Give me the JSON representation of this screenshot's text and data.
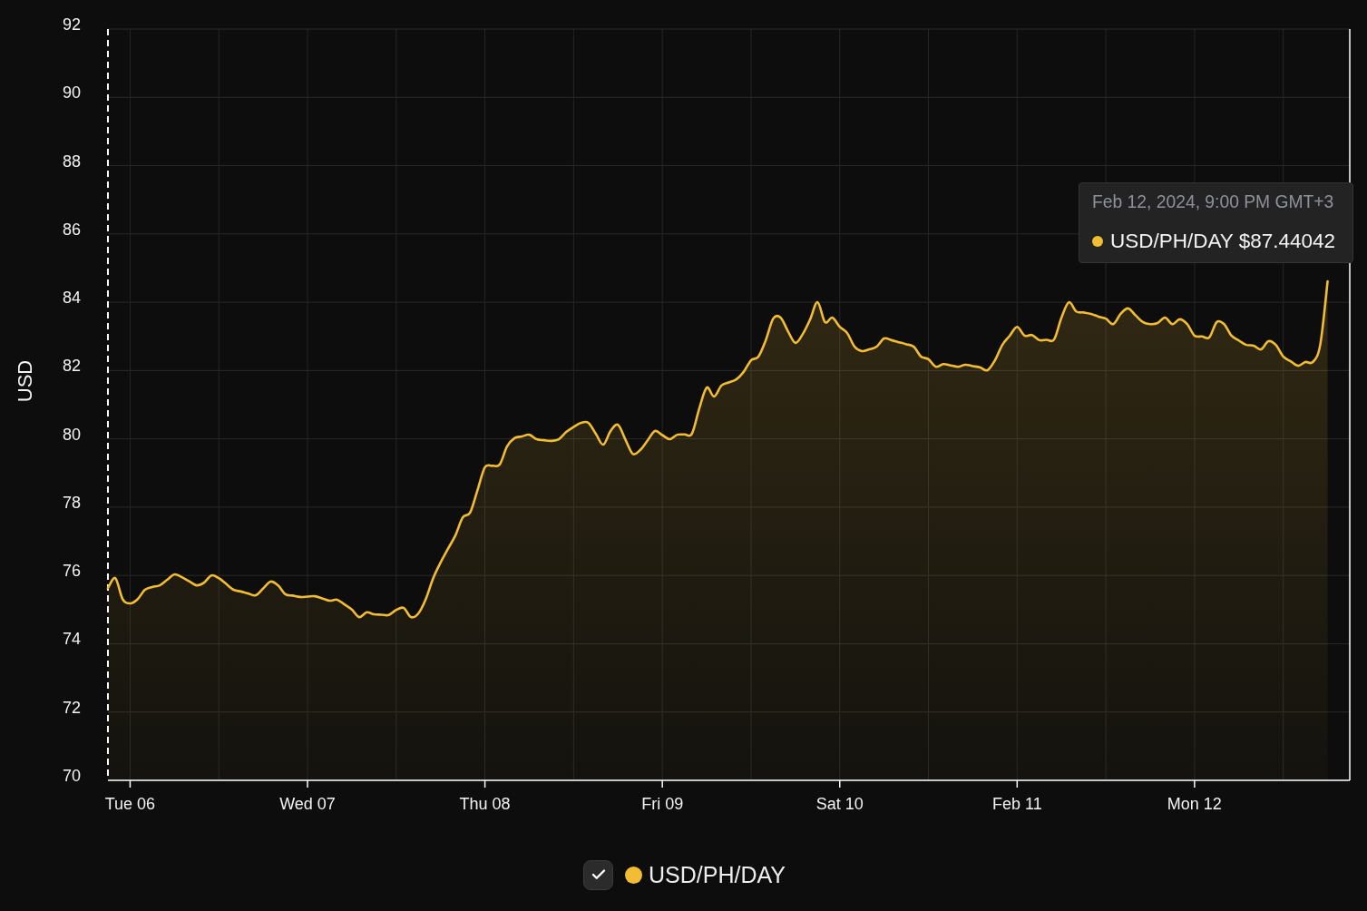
{
  "chart": {
    "chart_data": {
      "type": "area",
      "ylabel": "USD",
      "grid": true,
      "categories": [
        null,
        null,
        null,
        "Tue 06",
        null,
        null,
        null,
        null,
        null,
        null,
        null,
        null,
        null,
        null,
        null,
        null,
        null,
        null,
        null,
        null,
        null,
        null,
        null,
        null,
        null,
        null,
        null,
        "Wed 07",
        null,
        null,
        null,
        null,
        null,
        null,
        null,
        null,
        null,
        null,
        null,
        null,
        null,
        null,
        null,
        null,
        null,
        null,
        null,
        null,
        null,
        null,
        null,
        "Thu 08",
        null,
        null,
        null,
        null,
        null,
        null,
        null,
        null,
        null,
        null,
        null,
        null,
        null,
        null,
        null,
        null,
        null,
        null,
        null,
        null,
        null,
        null,
        null,
        "Fri 09",
        null,
        null,
        null,
        null,
        null,
        null,
        null,
        null,
        null,
        null,
        null,
        null,
        null,
        null,
        null,
        null,
        null,
        null,
        null,
        null,
        null,
        null,
        null,
        "Sat 10",
        null,
        null,
        null,
        null,
        null,
        null,
        null,
        null,
        null,
        null,
        null,
        null,
        null,
        null,
        null,
        null,
        null,
        null,
        null,
        null,
        null,
        null,
        null,
        "Feb 11",
        null,
        null,
        null,
        null,
        null,
        null,
        null,
        null,
        null,
        null,
        null,
        null,
        null,
        null,
        null,
        null,
        null,
        null,
        null,
        null,
        null,
        null,
        null,
        "Mon 12",
        null,
        null,
        null,
        null,
        null,
        null,
        null,
        null,
        null,
        null,
        null,
        null,
        null,
        null,
        null,
        null,
        null,
        null,
        null,
        null,
        null
      ],
      "series": [
        {
          "name": "USD/PH/DAY",
          "color": "#f2bd33",
          "values": [
            75.63,
            75.92,
            75.3,
            75.18,
            75.3,
            75.58,
            75.66,
            75.71,
            75.87,
            76.03,
            75.95,
            75.83,
            75.71,
            75.79,
            76.0,
            75.92,
            75.75,
            75.58,
            75.53,
            75.47,
            75.42,
            75.62,
            75.82,
            75.71,
            75.45,
            75.41,
            75.37,
            75.38,
            75.39,
            75.33,
            75.26,
            75.29,
            75.15,
            75.0,
            74.78,
            74.92,
            74.86,
            74.85,
            74.84,
            74.99,
            75.05,
            74.78,
            74.89,
            75.31,
            75.92,
            76.38,
            76.78,
            77.17,
            77.7,
            77.84,
            78.5,
            79.17,
            79.21,
            79.25,
            79.78,
            80.02,
            80.07,
            80.12,
            79.99,
            79.96,
            79.94,
            79.99,
            80.2,
            80.35,
            80.47,
            80.47,
            80.15,
            79.83,
            80.23,
            80.41,
            79.98,
            79.56,
            79.67,
            79.95,
            80.23,
            80.11,
            79.99,
            80.12,
            80.13,
            80.15,
            80.89,
            81.5,
            81.24,
            81.56,
            81.65,
            81.74,
            81.96,
            82.3,
            82.41,
            82.89,
            83.52,
            83.55,
            83.15,
            82.81,
            83.07,
            83.5,
            84.0,
            83.42,
            83.55,
            83.28,
            83.1,
            82.7,
            82.57,
            82.62,
            82.7,
            82.94,
            82.89,
            82.83,
            82.77,
            82.7,
            82.41,
            82.33,
            82.11,
            82.19,
            82.15,
            82.11,
            82.17,
            82.13,
            82.09,
            82.01,
            82.3,
            82.75,
            83.02,
            83.28,
            83.02,
            83.04,
            82.89,
            82.9,
            82.91,
            83.55,
            84.0,
            83.73,
            83.7,
            83.66,
            83.58,
            83.52,
            83.36,
            83.66,
            83.82,
            83.62,
            83.42,
            83.36,
            83.39,
            83.55,
            83.36,
            83.5,
            83.36,
            83.02,
            83.0,
            82.97,
            83.42,
            83.36,
            83.02,
            82.88,
            82.75,
            82.73,
            82.62,
            82.86,
            82.75,
            82.41,
            82.27,
            82.14,
            82.25,
            82.25,
            82.75,
            84.61,
            null,
            null,
            null
          ]
        }
      ],
      "ylim": [
        70,
        92
      ],
      "yticks": [
        70,
        72,
        74,
        76,
        78,
        80,
        82,
        84,
        86,
        88,
        90,
        92
      ]
    },
    "tooltip": {
      "title": "Feb 12, 2024, 9:00 PM GMT+3",
      "items": [
        {
          "text": "USD/PH/DAY $87.44042",
          "color": "#f2bd33"
        }
      ]
    }
  },
  "legend": {
    "items": [
      {
        "checked": true
      }
    ]
  }
}
